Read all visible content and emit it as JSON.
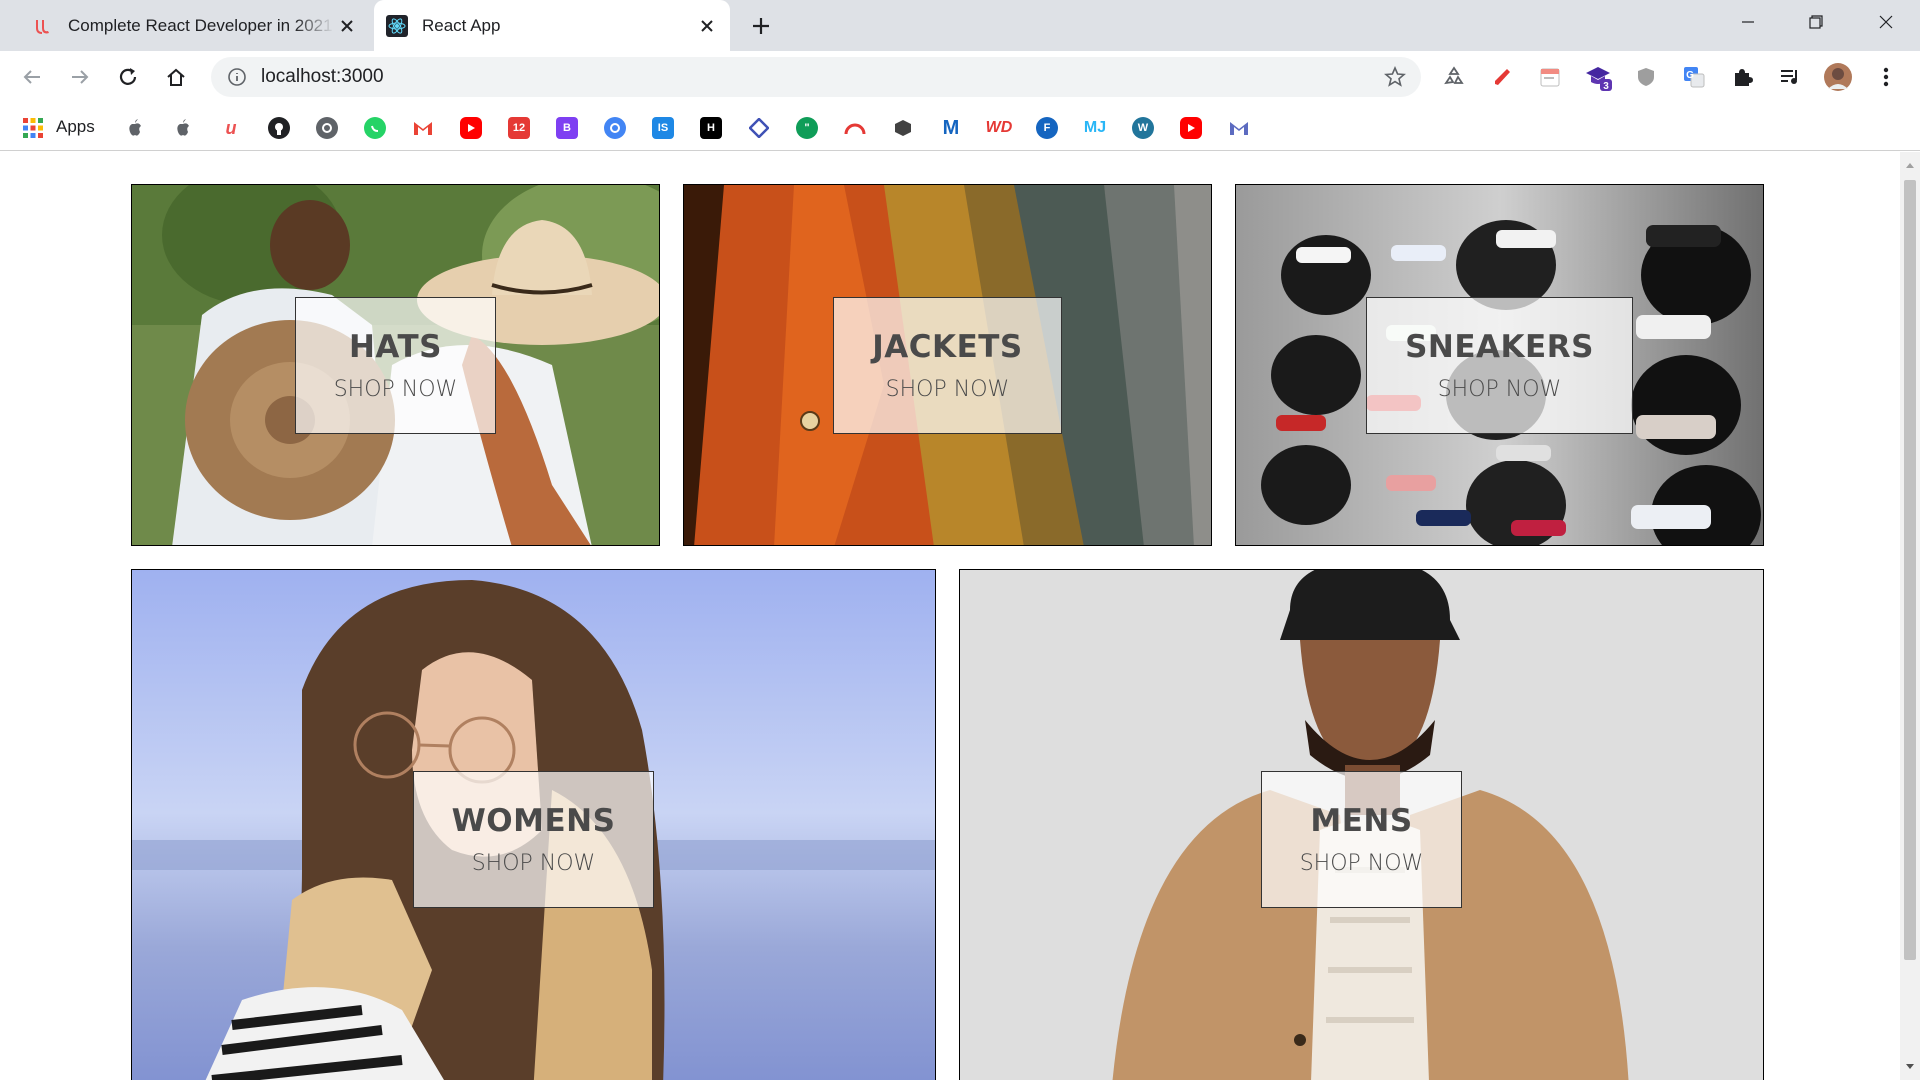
{
  "browser": {
    "tabs": [
      {
        "title": "Complete React Developer in 2021",
        "active": false
      },
      {
        "title": "React App",
        "active": true
      }
    ],
    "url": "localhost:3000",
    "extension_badge": "3",
    "bookmarks": {
      "apps_label": "Apps",
      "icons": [
        "apple-icon",
        "apple-icon",
        "udemy-icon",
        "github-icon",
        "codewars-icon",
        "whatsapp-icon",
        "gmail-icon",
        "youtube-icon",
        "calendar-icon",
        "bootstrap-icon",
        "chrome-icon",
        "is-icon",
        "hackerearth-icon",
        "diamond-icon",
        "hangouts-icon",
        "speedtest-icon",
        "box-icon",
        "m-icon",
        "wd-icon",
        "f-icon",
        "mj-icon",
        "wordpress-icon",
        "youtube-icon",
        "gmail-icon"
      ]
    }
  },
  "directory": {
    "sections": [
      {
        "title": "HATS",
        "subtitle": "SHOP NOW"
      },
      {
        "title": "JACKETS",
        "subtitle": "SHOP NOW"
      },
      {
        "title": "SNEAKERS",
        "subtitle": "SHOP NOW"
      },
      {
        "title": "WOMENS",
        "subtitle": "SHOP NOW"
      },
      {
        "title": "MENS",
        "subtitle": "SHOP NOW"
      }
    ]
  },
  "colors": {
    "chrome_bg": "#dee1e6",
    "content_bg": "rgba(255,255,255,0.7)",
    "text": "#4a4a4a"
  }
}
